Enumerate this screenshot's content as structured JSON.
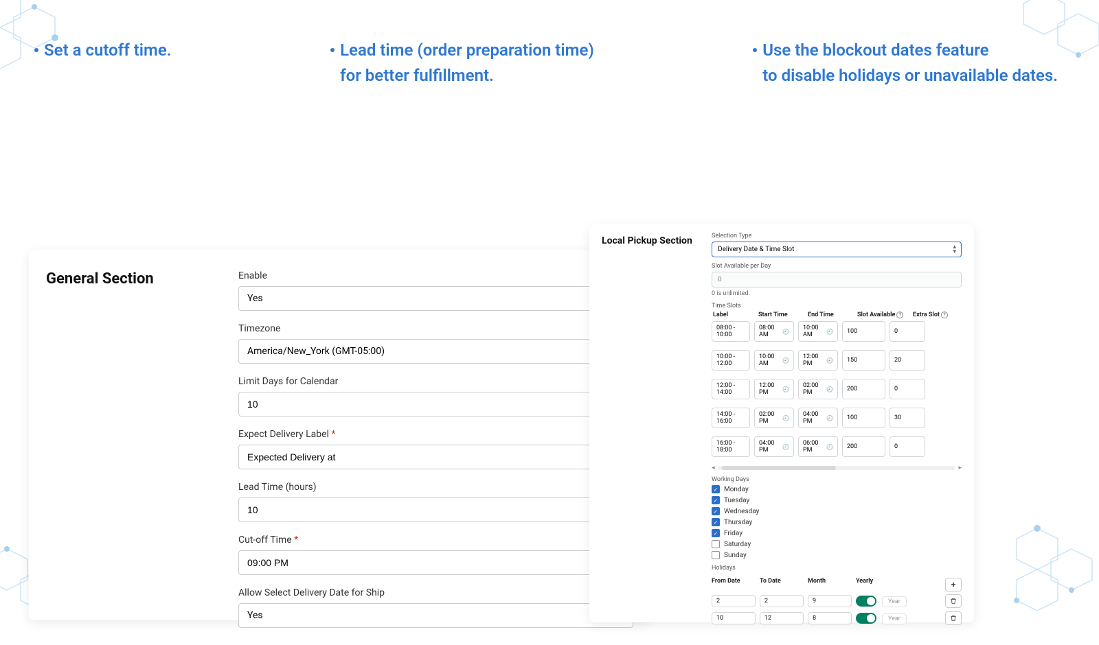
{
  "bullets": [
    "Set a cutoff time.",
    "Lead time (order preparation time)\nfor better fulfillment.",
    "Use the blockout dates feature\nto disable holidays or unavailable dates."
  ],
  "general": {
    "title": "General Section",
    "enable": {
      "label": "Enable",
      "value": "Yes"
    },
    "timezone": {
      "label": "Timezone",
      "value": "America/New_York (GMT-05:00)"
    },
    "limit_days": {
      "label": "Limit Days for Calendar",
      "value": "10"
    },
    "expect_label": {
      "label": "Expect Delivery Label",
      "value": "Expected Delivery at"
    },
    "lead_time": {
      "label": "Lead Time (hours)",
      "value": "10"
    },
    "cutoff": {
      "label": "Cut-off Time",
      "value": "09:00 PM"
    },
    "allow_ship": {
      "label": "Allow Select Delivery Date for Ship",
      "value": "Yes"
    }
  },
  "pickup": {
    "title": "Local Pickup Section",
    "selection_type": {
      "label": "Selection Type",
      "value": "Delivery Date & Time Slot"
    },
    "slot_per_day": {
      "label": "Slot Available per Day",
      "value": "0",
      "note": "0 is unlimited."
    },
    "time_slots_label": "Time Slots",
    "ts_cols": {
      "label": "Label",
      "start": "Start Time",
      "end": "End Time",
      "slot": "Slot Available",
      "extra": "Extra Slot"
    },
    "slots": [
      {
        "label": "08:00 - 10:00",
        "start": "08:00 AM",
        "end": "10:00 AM",
        "slot": "100",
        "extra": "0"
      },
      {
        "label": "10:00 - 12:00",
        "start": "10:00 AM",
        "end": "12:00 PM",
        "slot": "150",
        "extra": "20"
      },
      {
        "label": "12:00 - 14:00",
        "start": "12:00 PM",
        "end": "02:00 PM",
        "slot": "200",
        "extra": "0"
      },
      {
        "label": "14:00 - 16:00",
        "start": "02:00 PM",
        "end": "04:00 PM",
        "slot": "100",
        "extra": "30"
      },
      {
        "label": "16:00 - 18:00",
        "start": "04:00 PM",
        "end": "06:00 PM",
        "slot": "200",
        "extra": "0"
      }
    ],
    "working_days_label": "Working Days",
    "days": [
      {
        "name": "Monday",
        "on": true
      },
      {
        "name": "Tuesday",
        "on": true
      },
      {
        "name": "Wednesday",
        "on": true
      },
      {
        "name": "Thursday",
        "on": true
      },
      {
        "name": "Friday",
        "on": true
      },
      {
        "name": "Saturday",
        "on": false
      },
      {
        "name": "Sunday",
        "on": false
      }
    ],
    "holidays_label": "Holidays",
    "hol_cols": {
      "from": "From Date",
      "to": "To Date",
      "month": "Month",
      "yearly": "Yearly"
    },
    "year_label": "Year",
    "add": "+",
    "holidays": [
      {
        "from": "2",
        "to": "2",
        "month": "9"
      },
      {
        "from": "10",
        "to": "12",
        "month": "8"
      }
    ]
  }
}
